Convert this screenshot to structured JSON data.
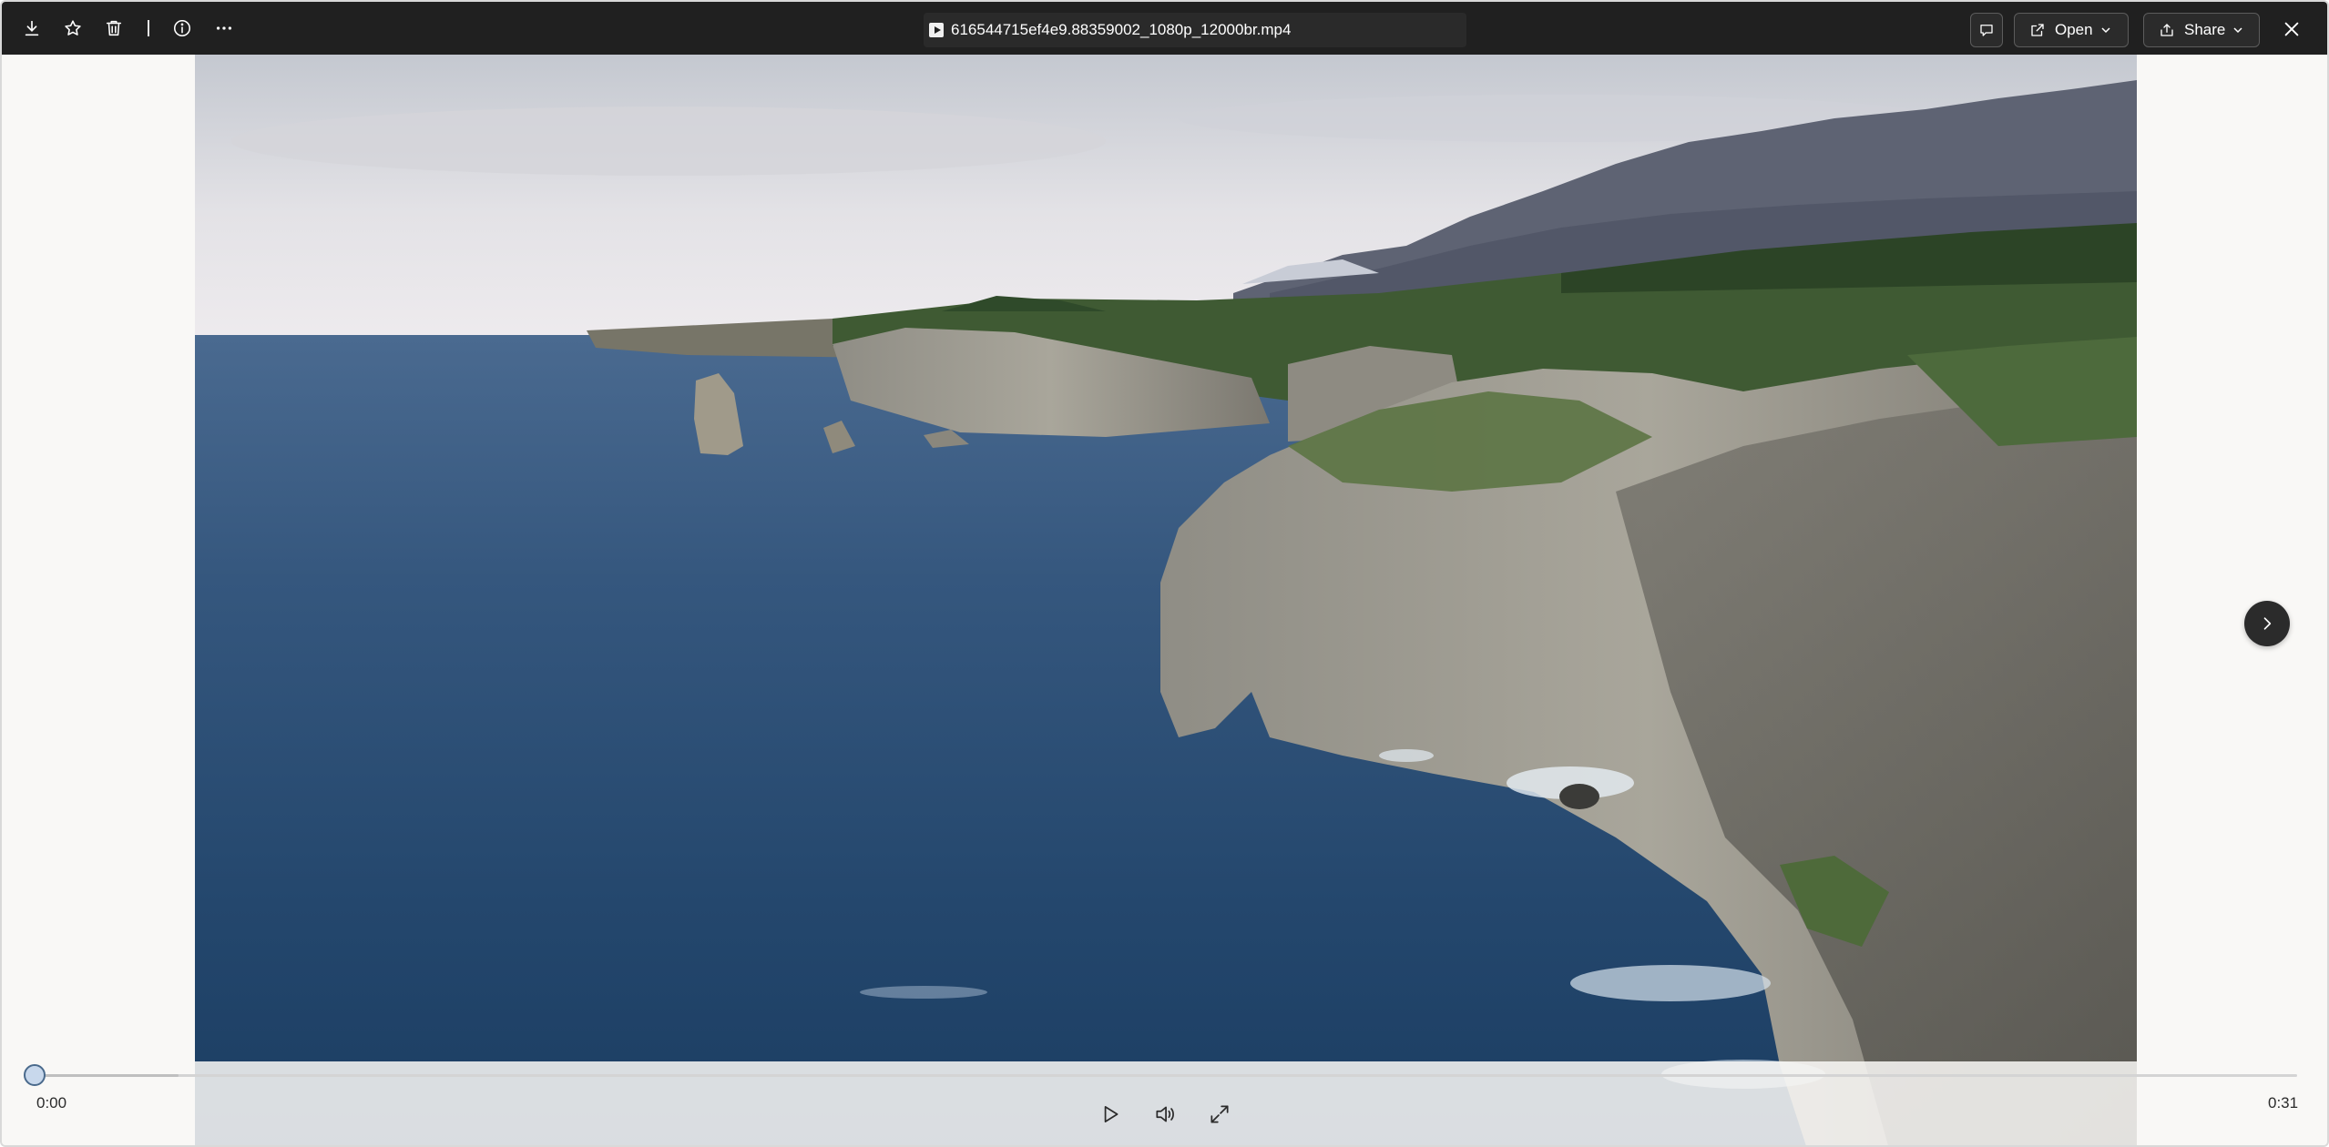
{
  "toolbar": {
    "filename": "616544715ef4e9.88359002_1080p_12000br.mp4",
    "open_label": "Open",
    "share_label": "Share"
  },
  "player": {
    "current_time": "0:00",
    "duration": "0:31",
    "progress": 0,
    "buffered_fraction": 0.063
  },
  "icons": {
    "download": "download-icon",
    "favorite": "star-icon",
    "delete": "trash-icon",
    "info": "info-icon",
    "more": "more-icon",
    "comment": "comment-icon",
    "open": "open-external-icon",
    "share": "share-icon",
    "close": "close-icon",
    "next": "chevron-right-icon",
    "play": "play-icon",
    "volume": "volume-icon",
    "fullscreen": "fullscreen-icon"
  },
  "colors": {
    "toolbar_bg": "#202020",
    "viewer_bg": "#f9f8f6",
    "seek_thumb_border": "#4a6a8c"
  }
}
